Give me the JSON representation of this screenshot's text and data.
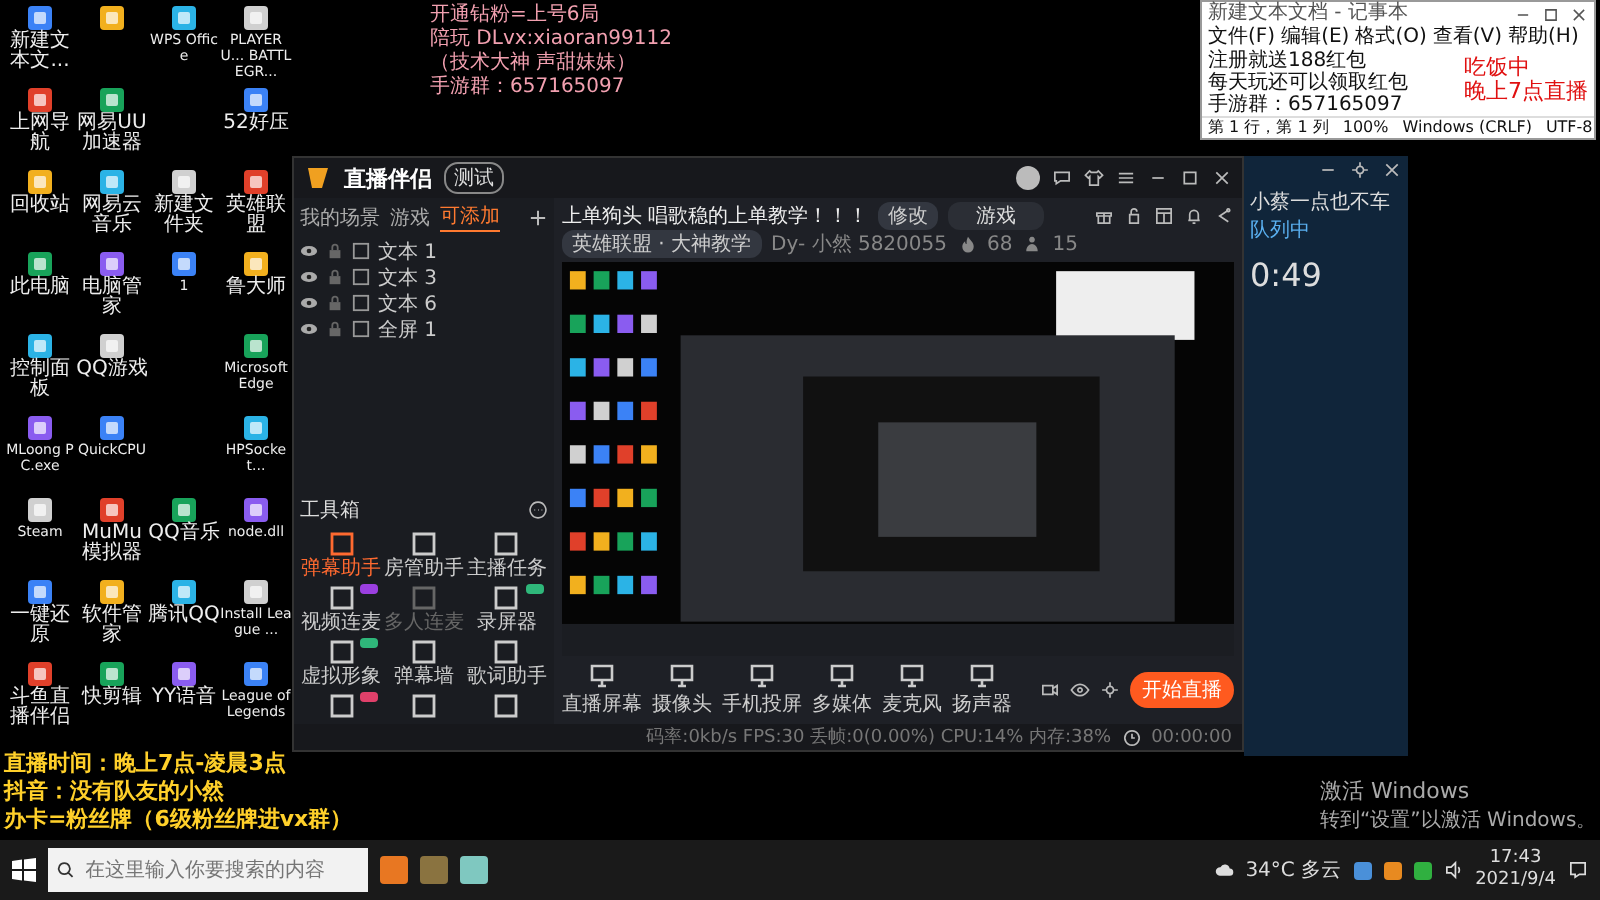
{
  "desktop_icons": [
    [
      {
        "kind": "app",
        "label": "新建文本文..."
      },
      {
        "kind": "app",
        "label": "上网导航"
      },
      {
        "kind": "app",
        "label": "回收站"
      },
      {
        "kind": "app",
        "label": "此电脑"
      },
      {
        "kind": "app",
        "label": "控制面板"
      },
      {
        "kind": "app",
        "label": "MLoong PC.exe"
      },
      {
        "kind": "app",
        "label": "Steam"
      },
      {
        "kind": "app",
        "label": "一键还原"
      },
      {
        "kind": "app",
        "label": "斗鱼直播伴侣"
      }
    ],
    [
      {
        "kind": "unlabeled"
      },
      {
        "kind": "app",
        "label": "网易UU加速器"
      },
      {
        "kind": "app",
        "label": "网易云音乐"
      },
      {
        "kind": "app",
        "label": "电脑管家"
      },
      {
        "kind": "app",
        "label": "QQ游戏"
      },
      {
        "kind": "app",
        "label": "QuickCPU"
      },
      {
        "kind": "app",
        "label": "MuMu模拟器"
      },
      {
        "kind": "app",
        "label": "软件管家"
      },
      {
        "kind": "app",
        "label": "快剪辑"
      }
    ],
    [
      {
        "kind": "app",
        "label": "WPS Office"
      },
      {
        "kind": "gap"
      },
      {
        "kind": "app",
        "label": "新建文件夹"
      },
      {
        "kind": "app",
        "label": "1"
      },
      {
        "kind": "gap"
      },
      {
        "kind": "gap"
      },
      {
        "kind": "app",
        "label": "QQ音乐"
      },
      {
        "kind": "app",
        "label": "腾讯QQ"
      },
      {
        "kind": "app",
        "label": "YY语音"
      }
    ],
    [
      {
        "kind": "app",
        "label": "PLAYERU... BATTLEGR..."
      },
      {
        "kind": "app",
        "label": "52好压"
      },
      {
        "kind": "app",
        "label": "英雄联盟"
      },
      {
        "kind": "app",
        "label": "鲁大师"
      },
      {
        "kind": "app",
        "label": "Microsoft Edge"
      },
      {
        "kind": "app",
        "label": "HPSocket..."
      },
      {
        "kind": "app",
        "label": "node.dll"
      },
      {
        "kind": "app",
        "label": "Install League ..."
      },
      {
        "kind": "app",
        "label": "League of Legends"
      }
    ]
  ],
  "overlay_top": [
    "开通钻粉=上号6局",
    "陪玩 DLvx:xiaoran99112",
    "（技术大神 声甜妹妹）",
    "手游群：657165097"
  ],
  "notepad": {
    "title": "新建文本文档 - 记事本",
    "menu": [
      "文件(F)",
      "编辑(E)",
      "格式(O)",
      "查看(V)",
      "帮助(H)"
    ],
    "lines": [
      "注册就送188红包",
      "每天玩还可以领取红包",
      "手游群：657165097"
    ],
    "status": [
      "第 1 行，第 1 列",
      "100%",
      "Windows (CRLF)",
      "UTF-8"
    ]
  },
  "overlay_red": [
    "吃饭中",
    "晚上7点直播"
  ],
  "side_panel": {
    "name": "小蔡一点也不车",
    "status": "队列中",
    "timer": "0:49"
  },
  "app": {
    "title": "直播伴侣",
    "badge": "测试",
    "scene_tabs": [
      {
        "label": "我的场景",
        "selected": false
      },
      {
        "label": "游戏",
        "selected": false
      },
      {
        "label": "可添加",
        "selected": true
      }
    ],
    "sources": [
      "文本 1",
      "文本 3",
      "文本 6",
      "全屏 1"
    ],
    "toolbox_title": "工具箱",
    "tools": [
      {
        "label": "弹幕助手",
        "highlighted": true,
        "disabled": false
      },
      {
        "label": "房管助手",
        "highlighted": false,
        "disabled": false
      },
      {
        "label": "主播任务",
        "highlighted": false,
        "disabled": false
      },
      {
        "label": "视频连麦",
        "highlighted": false,
        "disabled": false,
        "color": "#9b3fe0"
      },
      {
        "label": "多人连麦",
        "highlighted": false,
        "disabled": true
      },
      {
        "label": "录屏器",
        "highlighted": false,
        "disabled": false,
        "color": "#2fb77a"
      },
      {
        "label": "虚拟形象",
        "highlighted": false,
        "disabled": false,
        "color": "#2fb77a"
      },
      {
        "label": "弹幕墙",
        "highlighted": false,
        "disabled": false
      },
      {
        "label": "歌词助手",
        "highlighted": false,
        "disabled": false
      },
      {
        "highlighted": false,
        "disabled": false,
        "color": "#e0406a"
      },
      {
        "highlighted": false,
        "disabled": false
      },
      {
        "highlighted": false,
        "disabled": false
      }
    ],
    "room_title": "上单狗头 唱歌稳的上单教学！！！",
    "edit_button": "修改",
    "category_field": "游戏",
    "tag": "英雄联盟 · 大神教学",
    "room_id": "Dy- 小然  5820055",
    "hot": "68",
    "viewers": "15",
    "media": [
      "直播屏幕",
      "摄像头",
      "手机投屏",
      "多媒体",
      "麦克风",
      "扬声器"
    ],
    "start_button": "开始直播",
    "stats": "码率:0kb/s  FPS:30  丢帧:0(0.00%)  CPU:14%  内存:38%",
    "elapsed": "00:00:00"
  },
  "overlay_bottom": [
    "直播时间：晚上7点-凌晨3点",
    "抖音：没有队友的小然",
    "办卡=粉丝牌（6级粉丝牌进vx群）"
  ],
  "activate": {
    "title": "激活 Windows",
    "hint": "转到“设置”以激活 Windows。"
  },
  "taskbar": {
    "search_placeholder": "在这里输入你要搜索的内容",
    "weather": "34°C 多云",
    "time": "17:43",
    "date": "2021/9/4"
  }
}
